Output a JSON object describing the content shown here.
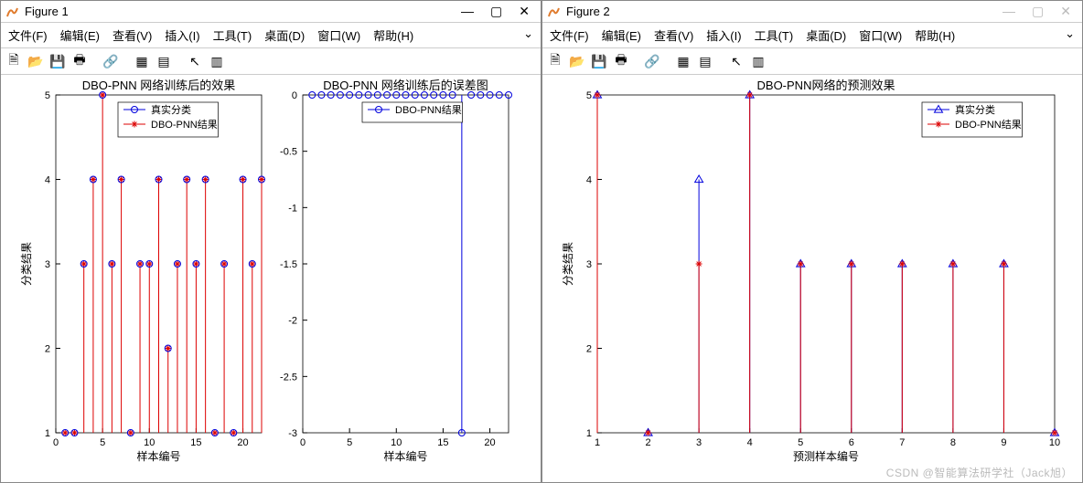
{
  "figure1": {
    "title": "Figure 1",
    "menus": [
      "文件(F)",
      "编辑(E)",
      "查看(V)",
      "插入(I)",
      "工具(T)",
      "桌面(D)",
      "窗口(W)",
      "帮助(H)"
    ],
    "win_min": "—",
    "win_max": "▢",
    "win_close": "✕",
    "menu_dropdown": "⌄"
  },
  "figure2": {
    "title": "Figure 2",
    "menus": [
      "文件(F)",
      "编辑(E)",
      "查看(V)",
      "插入(I)",
      "工具(T)",
      "桌面(D)",
      "窗口(W)",
      "帮助(H)"
    ],
    "win_min": "—",
    "win_max": "▢",
    "win_close": "✕",
    "menu_dropdown": "⌄"
  },
  "watermark": "CSDN @智能算法研学社（Jack旭）",
  "chart_data": [
    {
      "id": "train_effect",
      "title": "DBO-PNN 网络训练后的效果",
      "xlabel": "样本编号",
      "ylabel": "分类结果",
      "type": "stem",
      "xlim": [
        0,
        22
      ],
      "ylim": [
        1,
        5
      ],
      "xticks": [
        0,
        5,
        10,
        15,
        20
      ],
      "yticks": [
        1,
        2,
        3,
        4,
        5
      ],
      "legend": [
        "真实分类",
        "DBO-PNN结果"
      ],
      "x": [
        1,
        2,
        3,
        4,
        5,
        6,
        7,
        8,
        9,
        10,
        11,
        12,
        13,
        14,
        15,
        16,
        17,
        18,
        19,
        20,
        21,
        22
      ],
      "true_y": [
        1,
        1,
        3,
        4,
        5,
        3,
        4,
        1,
        3,
        3,
        4,
        2,
        3,
        4,
        3,
        4,
        1,
        3,
        1,
        4,
        3,
        4
      ],
      "pred_y": [
        1,
        1,
        3,
        4,
        5,
        3,
        4,
        1,
        3,
        3,
        4,
        2,
        3,
        4,
        3,
        4,
        1,
        3,
        1,
        4,
        3,
        4
      ]
    },
    {
      "id": "train_error",
      "title": "DBO-PNN 网络训练后的误差图",
      "xlabel": "样本编号",
      "ylabel": "",
      "type": "stem",
      "xlim": [
        0,
        22
      ],
      "ylim": [
        -3,
        0
      ],
      "xticks": [
        0,
        5,
        10,
        15,
        20
      ],
      "yticks": [
        -3,
        -2.5,
        -2,
        -1.5,
        -1,
        -0.5,
        0
      ],
      "legend": [
        "DBO-PNN结果"
      ],
      "x": [
        1,
        2,
        3,
        4,
        5,
        6,
        7,
        8,
        9,
        10,
        11,
        12,
        13,
        14,
        15,
        16,
        17,
        18,
        19,
        20,
        21,
        22
      ],
      "error": [
        0,
        0,
        0,
        0,
        0,
        0,
        0,
        0,
        0,
        0,
        0,
        0,
        0,
        0,
        0,
        0,
        -3,
        0,
        0,
        0,
        0,
        0
      ]
    },
    {
      "id": "predict",
      "title": "DBO-PNN网络的预测效果",
      "xlabel": "预测样本编号",
      "ylabel": "分类结果",
      "type": "stem",
      "xlim": [
        1,
        10
      ],
      "ylim": [
        1,
        5
      ],
      "xticks": [
        1,
        2,
        3,
        4,
        5,
        6,
        7,
        8,
        9,
        10
      ],
      "yticks": [
        1,
        2,
        3,
        4,
        5
      ],
      "legend": [
        "真实分类",
        "DBO-PNN结果"
      ],
      "x": [
        1,
        2,
        3,
        4,
        5,
        6,
        7,
        8,
        9,
        10
      ],
      "true_y": [
        5,
        1,
        4,
        5,
        3,
        3,
        3,
        3,
        3,
        1
      ],
      "pred_y": [
        5,
        1,
        3,
        5,
        3,
        3,
        3,
        3,
        3,
        1
      ]
    }
  ]
}
